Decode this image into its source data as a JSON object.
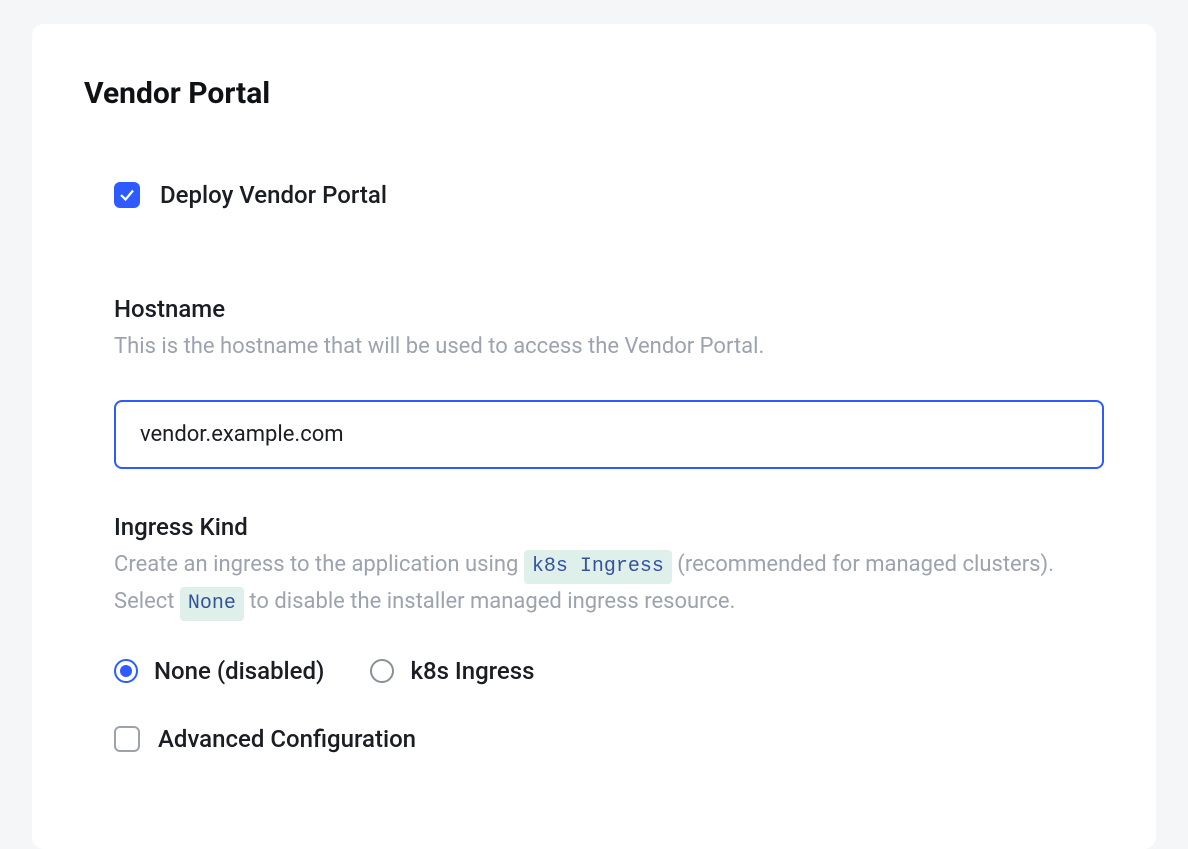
{
  "title": "Vendor Portal",
  "deploy": {
    "label": "Deploy Vendor Portal",
    "checked": true
  },
  "hostname": {
    "label": "Hostname",
    "help": "This is the hostname that will be used to access the Vendor Portal.",
    "value": "vendor.example.com"
  },
  "ingress": {
    "label": "Ingress Kind",
    "help_prefix": "Create an ingress to the application using ",
    "help_code1": "k8s Ingress",
    "help_mid": " (recommended for managed clusters). Select ",
    "help_code2": "None",
    "help_suffix": " to disable the installer managed ingress resource.",
    "options": {
      "none": "None (disabled)",
      "k8s": "k8s Ingress"
    },
    "selected": "none"
  },
  "advanced": {
    "label": "Advanced Configuration",
    "checked": false
  }
}
